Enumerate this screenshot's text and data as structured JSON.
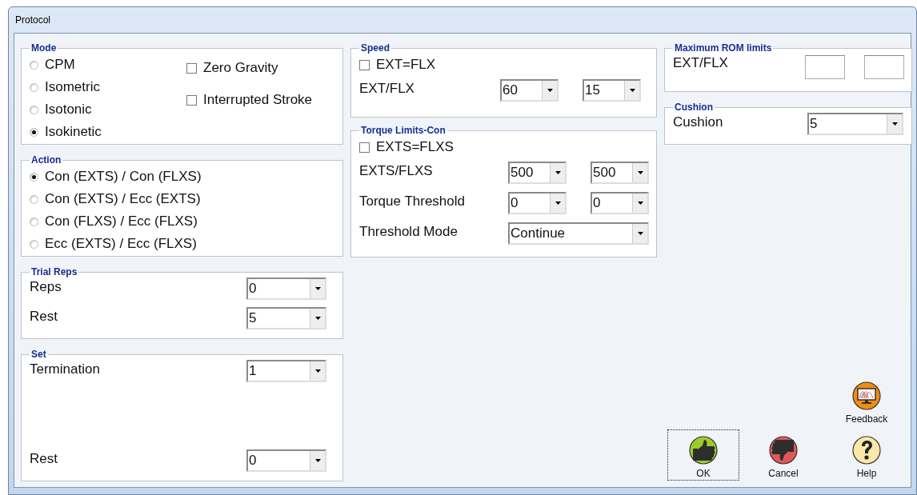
{
  "window": {
    "title": "Protocol"
  },
  "mode": {
    "title": "Mode",
    "options": [
      {
        "label": "CPM",
        "selected": false
      },
      {
        "label": "Isometric",
        "selected": false
      },
      {
        "label": "Isotonic",
        "selected": false
      },
      {
        "label": "Isokinetic",
        "selected": true
      }
    ],
    "checkboxes": [
      {
        "label": "Zero Gravity",
        "checked": false
      },
      {
        "label": "Interrupted Stroke",
        "checked": false
      }
    ]
  },
  "action": {
    "title": "Action",
    "options": [
      {
        "label": "Con (EXTS) / Con (FLXS)",
        "selected": true
      },
      {
        "label": "Con (EXTS) / Ecc (EXTS)",
        "selected": false
      },
      {
        "label": "Con (FLXS) / Ecc (FLXS)",
        "selected": false
      },
      {
        "label": "Ecc (EXTS) / Ecc (FLXS)",
        "selected": false
      }
    ]
  },
  "trial_reps": {
    "title": "Trial Reps",
    "rows": [
      {
        "label": "Reps",
        "fields": [
          {
            "kind": "dropdown",
            "value": "0"
          }
        ]
      },
      {
        "label": "Rest",
        "fields": [
          {
            "kind": "dropdown",
            "value": "5"
          }
        ]
      }
    ]
  },
  "set": {
    "title": "Set",
    "rows": [
      {
        "label": "Termination",
        "fields": [
          {
            "kind": "dropdown",
            "value": "1"
          }
        ]
      },
      {
        "label": "Rest",
        "fields": [
          {
            "kind": "dropdown",
            "value": "0"
          }
        ]
      }
    ]
  },
  "speed": {
    "title": "Speed",
    "checkbox": {
      "label": "EXT=FLX",
      "checked": false
    },
    "rows": [
      {
        "label": "EXT/FLX",
        "fields": [
          {
            "kind": "dropdown",
            "value": "60"
          },
          {
            "kind": "dropdown",
            "value": "15"
          }
        ]
      }
    ]
  },
  "torque_limits": {
    "title": "Torque Limits-Con",
    "checkbox": {
      "label": "EXTS=FLXS",
      "checked": false
    },
    "rows": [
      {
        "label": "EXTS/FLXS",
        "fields": [
          {
            "kind": "dropdown",
            "value": "500"
          },
          {
            "kind": "dropdown",
            "value": "500"
          }
        ]
      },
      {
        "label": "Torque Threshold",
        "fields": [
          {
            "kind": "dropdown",
            "value": "0"
          },
          {
            "kind": "dropdown",
            "value": "0"
          }
        ]
      },
      {
        "label": "Threshold Mode",
        "fields": [
          {
            "kind": "wide_dropdown",
            "value": "Continue"
          }
        ]
      }
    ]
  },
  "max_rom": {
    "title": "Maximum ROM limits",
    "rows": [
      {
        "label": "EXT/FLX",
        "fields": [
          {
            "kind": "text"
          },
          {
            "kind": "text"
          }
        ]
      }
    ]
  },
  "cushion": {
    "title": "Cushion",
    "rows": [
      {
        "label": "Cushion",
        "fields": [
          {
            "kind": "wide_dropdown",
            "value": "5"
          }
        ]
      }
    ]
  },
  "buttons": [
    {
      "label": "Feedback",
      "kind": "feedback",
      "focused": false
    },
    {
      "label": "OK",
      "kind": "ok",
      "focused": true
    },
    {
      "label": "Cancel",
      "kind": "cancel",
      "focused": false
    },
    {
      "label": "Help",
      "kind": "help",
      "focused": false
    }
  ]
}
